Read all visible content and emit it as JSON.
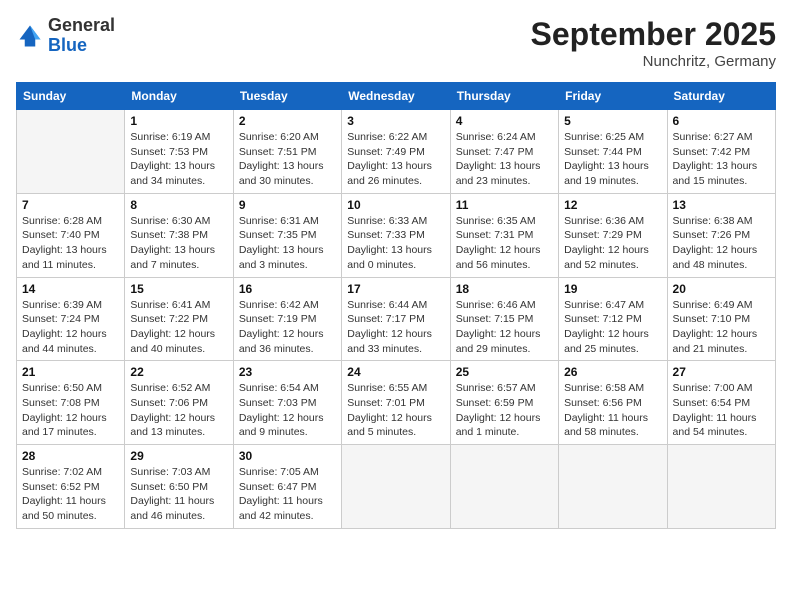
{
  "logo": {
    "general": "General",
    "blue": "Blue"
  },
  "header": {
    "month": "September 2025",
    "location": "Nunchritz, Germany"
  },
  "weekdays": [
    "Sunday",
    "Monday",
    "Tuesday",
    "Wednesday",
    "Thursday",
    "Friday",
    "Saturday"
  ],
  "weeks": [
    [
      {
        "day": "",
        "detail": ""
      },
      {
        "day": "1",
        "detail": "Sunrise: 6:19 AM\nSunset: 7:53 PM\nDaylight: 13 hours\nand 34 minutes."
      },
      {
        "day": "2",
        "detail": "Sunrise: 6:20 AM\nSunset: 7:51 PM\nDaylight: 13 hours\nand 30 minutes."
      },
      {
        "day": "3",
        "detail": "Sunrise: 6:22 AM\nSunset: 7:49 PM\nDaylight: 13 hours\nand 26 minutes."
      },
      {
        "day": "4",
        "detail": "Sunrise: 6:24 AM\nSunset: 7:47 PM\nDaylight: 13 hours\nand 23 minutes."
      },
      {
        "day": "5",
        "detail": "Sunrise: 6:25 AM\nSunset: 7:44 PM\nDaylight: 13 hours\nand 19 minutes."
      },
      {
        "day": "6",
        "detail": "Sunrise: 6:27 AM\nSunset: 7:42 PM\nDaylight: 13 hours\nand 15 minutes."
      }
    ],
    [
      {
        "day": "7",
        "detail": "Sunrise: 6:28 AM\nSunset: 7:40 PM\nDaylight: 13 hours\nand 11 minutes."
      },
      {
        "day": "8",
        "detail": "Sunrise: 6:30 AM\nSunset: 7:38 PM\nDaylight: 13 hours\nand 7 minutes."
      },
      {
        "day": "9",
        "detail": "Sunrise: 6:31 AM\nSunset: 7:35 PM\nDaylight: 13 hours\nand 3 minutes."
      },
      {
        "day": "10",
        "detail": "Sunrise: 6:33 AM\nSunset: 7:33 PM\nDaylight: 13 hours\nand 0 minutes."
      },
      {
        "day": "11",
        "detail": "Sunrise: 6:35 AM\nSunset: 7:31 PM\nDaylight: 12 hours\nand 56 minutes."
      },
      {
        "day": "12",
        "detail": "Sunrise: 6:36 AM\nSunset: 7:29 PM\nDaylight: 12 hours\nand 52 minutes."
      },
      {
        "day": "13",
        "detail": "Sunrise: 6:38 AM\nSunset: 7:26 PM\nDaylight: 12 hours\nand 48 minutes."
      }
    ],
    [
      {
        "day": "14",
        "detail": "Sunrise: 6:39 AM\nSunset: 7:24 PM\nDaylight: 12 hours\nand 44 minutes."
      },
      {
        "day": "15",
        "detail": "Sunrise: 6:41 AM\nSunset: 7:22 PM\nDaylight: 12 hours\nand 40 minutes."
      },
      {
        "day": "16",
        "detail": "Sunrise: 6:42 AM\nSunset: 7:19 PM\nDaylight: 12 hours\nand 36 minutes."
      },
      {
        "day": "17",
        "detail": "Sunrise: 6:44 AM\nSunset: 7:17 PM\nDaylight: 12 hours\nand 33 minutes."
      },
      {
        "day": "18",
        "detail": "Sunrise: 6:46 AM\nSunset: 7:15 PM\nDaylight: 12 hours\nand 29 minutes."
      },
      {
        "day": "19",
        "detail": "Sunrise: 6:47 AM\nSunset: 7:12 PM\nDaylight: 12 hours\nand 25 minutes."
      },
      {
        "day": "20",
        "detail": "Sunrise: 6:49 AM\nSunset: 7:10 PM\nDaylight: 12 hours\nand 21 minutes."
      }
    ],
    [
      {
        "day": "21",
        "detail": "Sunrise: 6:50 AM\nSunset: 7:08 PM\nDaylight: 12 hours\nand 17 minutes."
      },
      {
        "day": "22",
        "detail": "Sunrise: 6:52 AM\nSunset: 7:06 PM\nDaylight: 12 hours\nand 13 minutes."
      },
      {
        "day": "23",
        "detail": "Sunrise: 6:54 AM\nSunset: 7:03 PM\nDaylight: 12 hours\nand 9 minutes."
      },
      {
        "day": "24",
        "detail": "Sunrise: 6:55 AM\nSunset: 7:01 PM\nDaylight: 12 hours\nand 5 minutes."
      },
      {
        "day": "25",
        "detail": "Sunrise: 6:57 AM\nSunset: 6:59 PM\nDaylight: 12 hours\nand 1 minute."
      },
      {
        "day": "26",
        "detail": "Sunrise: 6:58 AM\nSunset: 6:56 PM\nDaylight: 11 hours\nand 58 minutes."
      },
      {
        "day": "27",
        "detail": "Sunrise: 7:00 AM\nSunset: 6:54 PM\nDaylight: 11 hours\nand 54 minutes."
      }
    ],
    [
      {
        "day": "28",
        "detail": "Sunrise: 7:02 AM\nSunset: 6:52 PM\nDaylight: 11 hours\nand 50 minutes."
      },
      {
        "day": "29",
        "detail": "Sunrise: 7:03 AM\nSunset: 6:50 PM\nDaylight: 11 hours\nand 46 minutes."
      },
      {
        "day": "30",
        "detail": "Sunrise: 7:05 AM\nSunset: 6:47 PM\nDaylight: 11 hours\nand 42 minutes."
      },
      {
        "day": "",
        "detail": ""
      },
      {
        "day": "",
        "detail": ""
      },
      {
        "day": "",
        "detail": ""
      },
      {
        "day": "",
        "detail": ""
      }
    ]
  ]
}
